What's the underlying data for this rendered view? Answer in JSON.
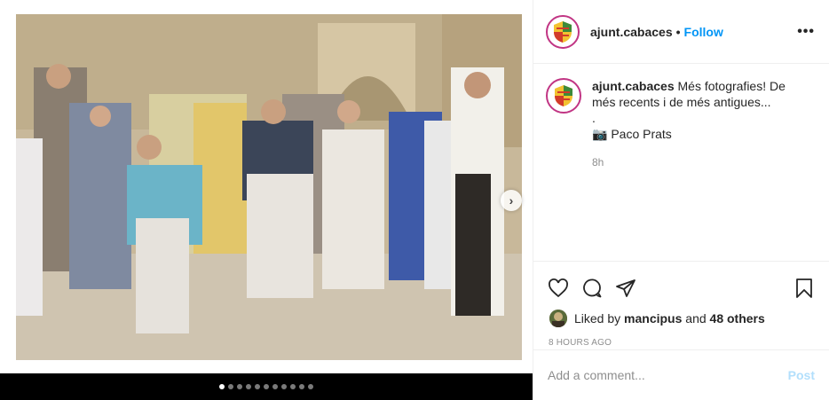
{
  "post": {
    "username": "ajunt.cabaces",
    "separator": "•",
    "follow_label": "Follow",
    "more_label": "•••"
  },
  "media": {
    "photo_description_icon": "photo",
    "next_label": "›",
    "dot_count": 11,
    "active_dot": 0
  },
  "caption": {
    "username": "ajunt.cabaces",
    "line1": "Més fotografies! De",
    "line2": "més recents i de més antigues...",
    "line3": ".",
    "camera_icon": "📷",
    "credit": "Paco Prats",
    "time": "8h"
  },
  "actions": {
    "like_icon": "heart-icon",
    "comment_icon": "comment-icon",
    "share_icon": "share-icon",
    "save_icon": "bookmark-icon"
  },
  "likes": {
    "prefix": "Liked by",
    "user": "mancipus",
    "and": "and",
    "others": "48 others"
  },
  "timestamp": "8 HOURS AGO",
  "comment": {
    "placeholder": "Add a comment...",
    "post_label": "Post"
  },
  "colors": {
    "accent": "#0095f6",
    "post_disabled": "#b2dffc",
    "muted": "#8e8e8e"
  }
}
